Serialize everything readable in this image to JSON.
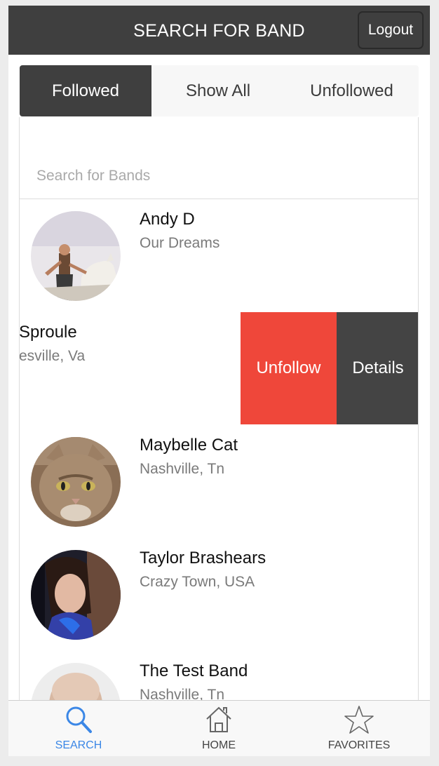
{
  "header": {
    "title": "SEARCH FOR BAND",
    "logout_label": "Logout"
  },
  "segments": [
    {
      "label": "Followed",
      "active": true
    },
    {
      "label": "Show All",
      "active": false
    },
    {
      "label": "Unfollowed",
      "active": false
    }
  ],
  "search": {
    "placeholder": "Search for Bands",
    "value": ""
  },
  "bands": [
    {
      "name": "Andy D",
      "location": "Our Dreams",
      "avatar_icon": "avatar-man-on-horse"
    },
    {
      "name": "Sproule",
      "location": "esville, Va",
      "swiped": true,
      "unfollow_label": "Unfollow",
      "details_label": "Details"
    },
    {
      "name": "Maybelle Cat",
      "location": "Nashville, Tn",
      "avatar_icon": "avatar-cat"
    },
    {
      "name": "Taylor Brashears",
      "location": "Crazy Town, USA",
      "avatar_icon": "avatar-woman"
    },
    {
      "name": "The Test Band",
      "location": "Nashville, Tn",
      "avatar_icon": "avatar-bald-man"
    }
  ],
  "tabbar": [
    {
      "label": "SEARCH",
      "icon": "search-icon",
      "active": true
    },
    {
      "label": "HOME",
      "icon": "home-icon",
      "active": false
    },
    {
      "label": "FAVORITES",
      "icon": "star-icon",
      "active": false
    }
  ],
  "colors": {
    "header_bg": "#3f3f3f",
    "unfollow_red": "#ef473a",
    "details_dark": "#444444",
    "active_tab_blue": "#3b87e6"
  }
}
